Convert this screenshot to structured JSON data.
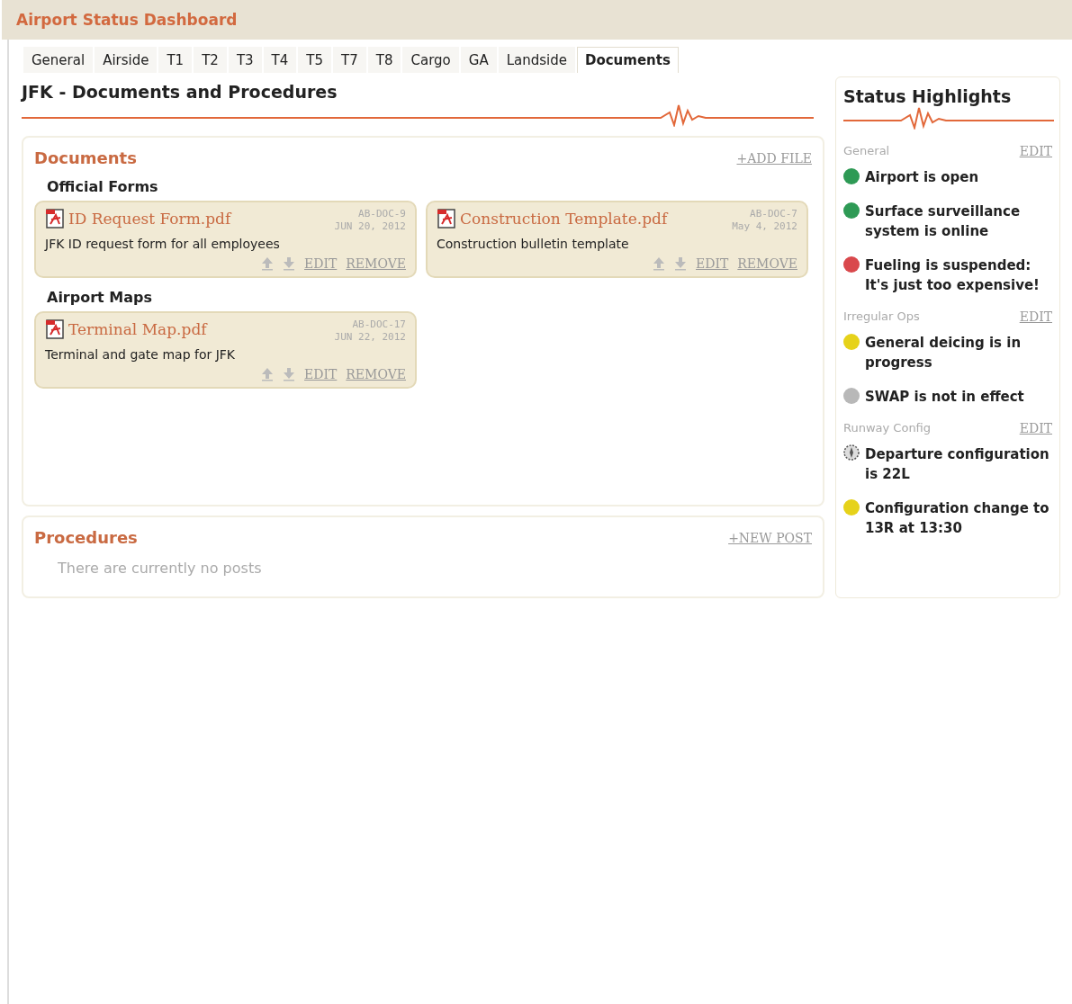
{
  "app": {
    "title": "Airport Status Dashboard"
  },
  "tabs": [
    {
      "label": "General",
      "selected": false
    },
    {
      "label": "Airside",
      "selected": false
    },
    {
      "label": "T1",
      "selected": false
    },
    {
      "label": "T2",
      "selected": false
    },
    {
      "label": "T3",
      "selected": false
    },
    {
      "label": "T4",
      "selected": false
    },
    {
      "label": "T5",
      "selected": false
    },
    {
      "label": "T7",
      "selected": false
    },
    {
      "label": "T8",
      "selected": false
    },
    {
      "label": "Cargo",
      "selected": false
    },
    {
      "label": "GA",
      "selected": false
    },
    {
      "label": "Landside",
      "selected": false
    },
    {
      "label": "Documents",
      "selected": true
    }
  ],
  "page_heading": "JFK - Documents and Procedures",
  "documents": {
    "title": "Documents",
    "add_link": "+ADD FILE",
    "groups": [
      {
        "title": "Official Forms",
        "files": [
          {
            "name": "ID Request Form.pdf",
            "doc_id": "AB-DOC-9",
            "date": "JUN 20, 2012",
            "description": "JFK ID request form for all employees",
            "edit": "EDIT",
            "remove": "REMOVE"
          },
          {
            "name": "Construction Template.pdf",
            "doc_id": "AB-DOC-7",
            "date": "May 4, 2012",
            "description": "Construction bulletin template",
            "edit": "EDIT",
            "remove": "REMOVE"
          }
        ]
      },
      {
        "title": "Airport Maps",
        "files": [
          {
            "name": "Terminal Map.pdf",
            "doc_id": "AB-DOC-17",
            "date": "JUN 22, 2012",
            "description": "Terminal and gate map for JFK",
            "edit": "EDIT",
            "remove": "REMOVE"
          }
        ]
      }
    ]
  },
  "procedures": {
    "title": "Procedures",
    "new_link": "+NEW POST",
    "empty_text": "There are currently no posts"
  },
  "status_highlights": {
    "title": "Status Highlights",
    "sections": [
      {
        "title": "General",
        "edit": "EDIT",
        "items": [
          {
            "kind": "dot",
            "color": "#2e9a55",
            "text": "Airport is open"
          },
          {
            "kind": "dot",
            "color": "#2e9a55",
            "text": "Surface surveillance system is online"
          },
          {
            "kind": "dot",
            "color": "#d9484c",
            "text": "Fueling is suspended: It's just too expensive!"
          }
        ]
      },
      {
        "title": "Irregular Ops",
        "edit": "EDIT",
        "items": [
          {
            "kind": "dot",
            "color": "#e6d21a",
            "text": "General deicing is in progress"
          },
          {
            "kind": "dot",
            "color": "#b8b8b8",
            "text": "SWAP is not in effect"
          }
        ]
      },
      {
        "title": "Runway Config",
        "edit": "EDIT",
        "items": [
          {
            "kind": "runway",
            "text": "Departure configuration is 22L"
          },
          {
            "kind": "dot",
            "color": "#e6d21a",
            "text": "Configuration change to 13R at 13:30"
          }
        ]
      }
    ]
  }
}
